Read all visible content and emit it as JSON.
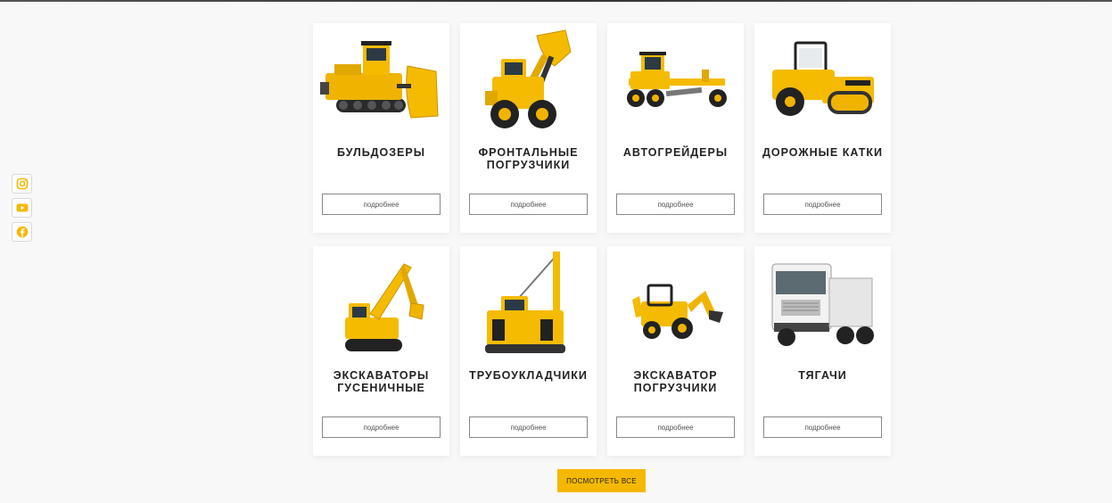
{
  "social": [
    {
      "icon": "instagram-icon"
    },
    {
      "icon": "youtube-icon"
    },
    {
      "icon": "facebook-icon"
    }
  ],
  "accent_color": "#f5b800",
  "cards": [
    {
      "title": "БУЛЬДОЗЕРЫ",
      "button": "подробнее",
      "image": "bulldozer"
    },
    {
      "title": "ФРОНТАЛЬНЫЕ ПОГРУЗЧИКИ",
      "button": "подробнее",
      "image": "wheel-loader"
    },
    {
      "title": "АВТОГРЕЙДЕРЫ",
      "button": "подробнее",
      "image": "motor-grader"
    },
    {
      "title": "ДОРОЖНЫЕ КАТКИ",
      "button": "подробнее",
      "image": "road-roller"
    },
    {
      "title": "ЭКСКАВАТОРЫ ГУСЕНИЧНЫЕ",
      "button": "подробнее",
      "image": "crawler-excavator"
    },
    {
      "title": "ТРУБОУКЛАДЧИКИ",
      "button": "подробнее",
      "image": "pipelayer"
    },
    {
      "title": "ЭКСКАВАТОР ПОГРУЗЧИКИ",
      "button": "подробнее",
      "image": "backhoe-loader"
    },
    {
      "title": "ТЯГАЧИ",
      "button": "подробнее",
      "image": "tractor-truck"
    }
  ],
  "view_all": "ПОСМОТРЕТЬ ВСЕ"
}
